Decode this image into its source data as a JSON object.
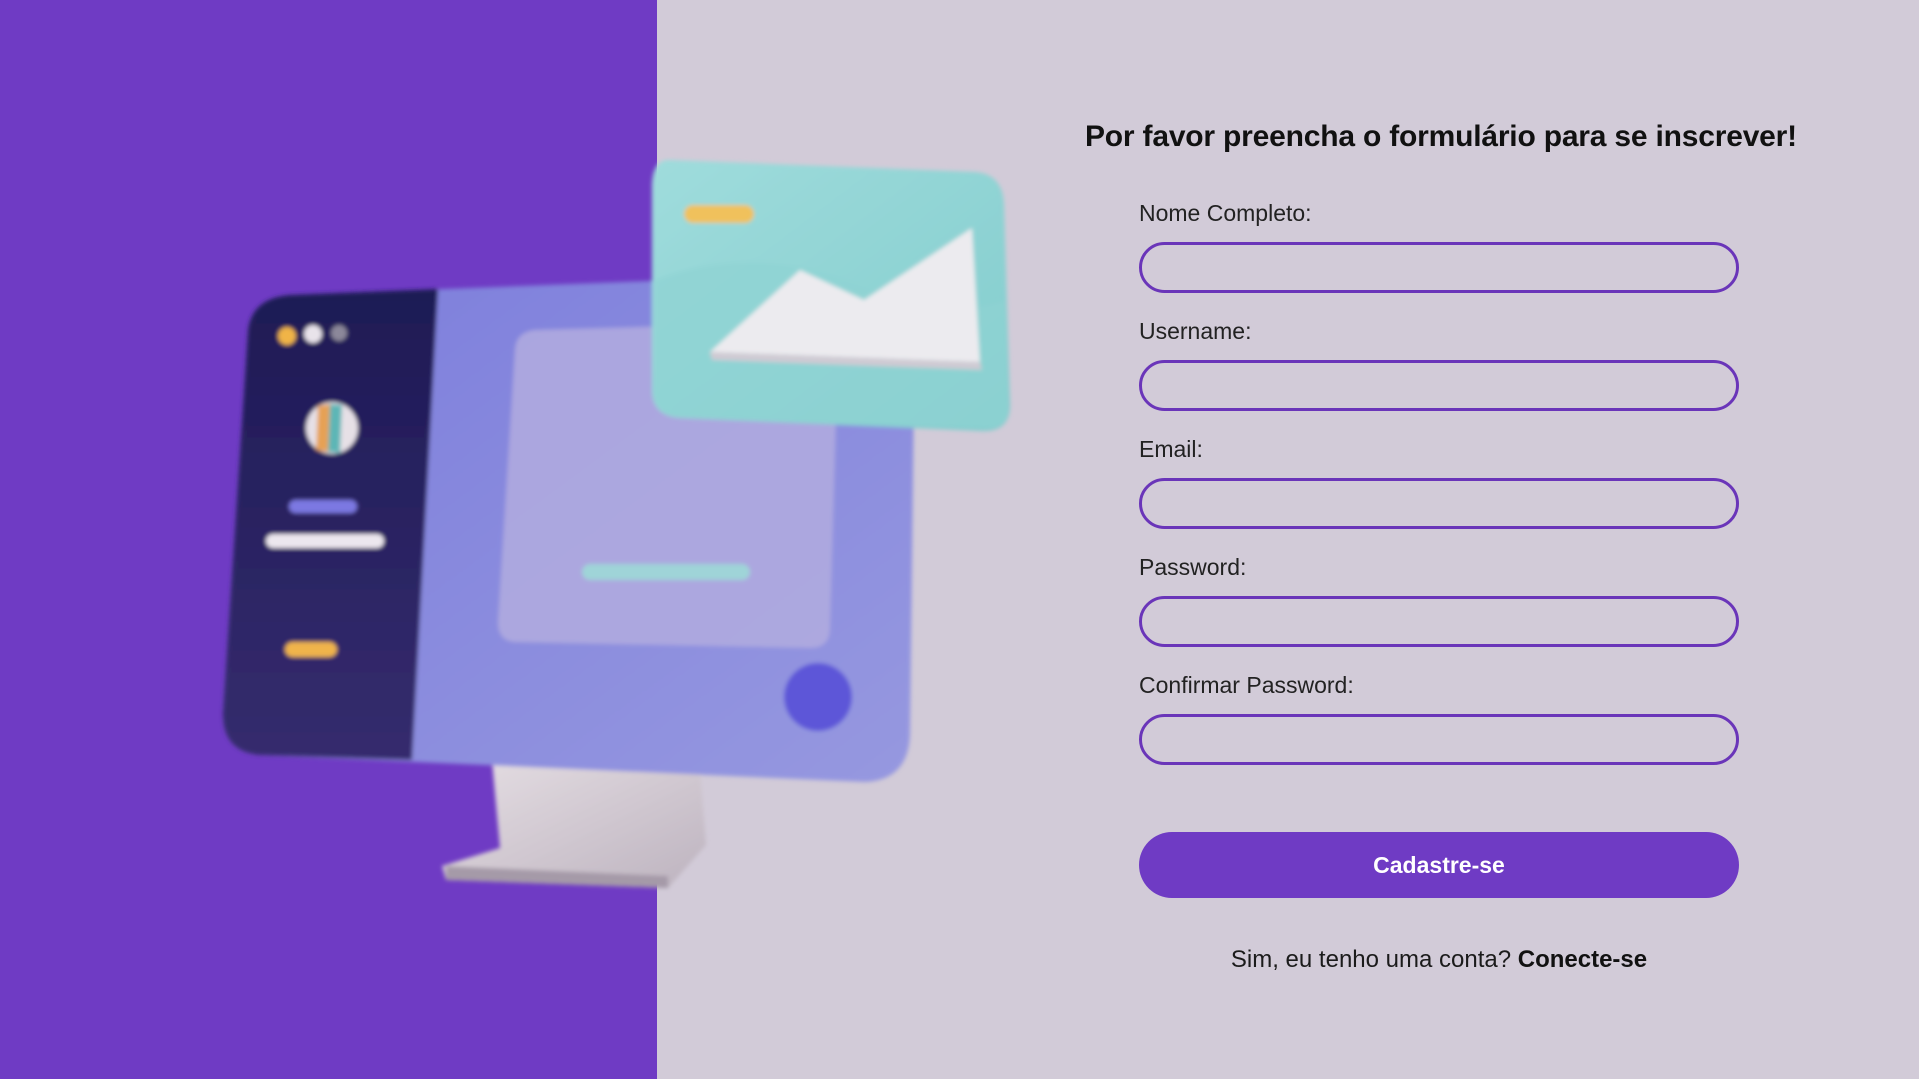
{
  "colors": {
    "left_panel": "#6f3bc4",
    "page_background": "#d2cbd8",
    "input_border": "#6a35b9",
    "button_background": "#6f3bc4",
    "button_text": "#ffffff"
  },
  "illustration": {
    "icon": "desktop-computer-3d-icon"
  },
  "form": {
    "title": "Por favor preencha o formulário para se inscrever!",
    "fields": [
      {
        "label": "Nome Completo:",
        "value": "",
        "placeholder": ""
      },
      {
        "label": "Username:",
        "value": "",
        "placeholder": ""
      },
      {
        "label": "Email:",
        "value": "",
        "placeholder": ""
      },
      {
        "label": "Password:",
        "value": "",
        "placeholder": ""
      },
      {
        "label": "Confirmar Password:",
        "value": "",
        "placeholder": ""
      }
    ],
    "submit_label": "Cadastre-se",
    "login_prompt": "Sim, eu tenho uma conta?",
    "login_link": "Conecte-se"
  }
}
